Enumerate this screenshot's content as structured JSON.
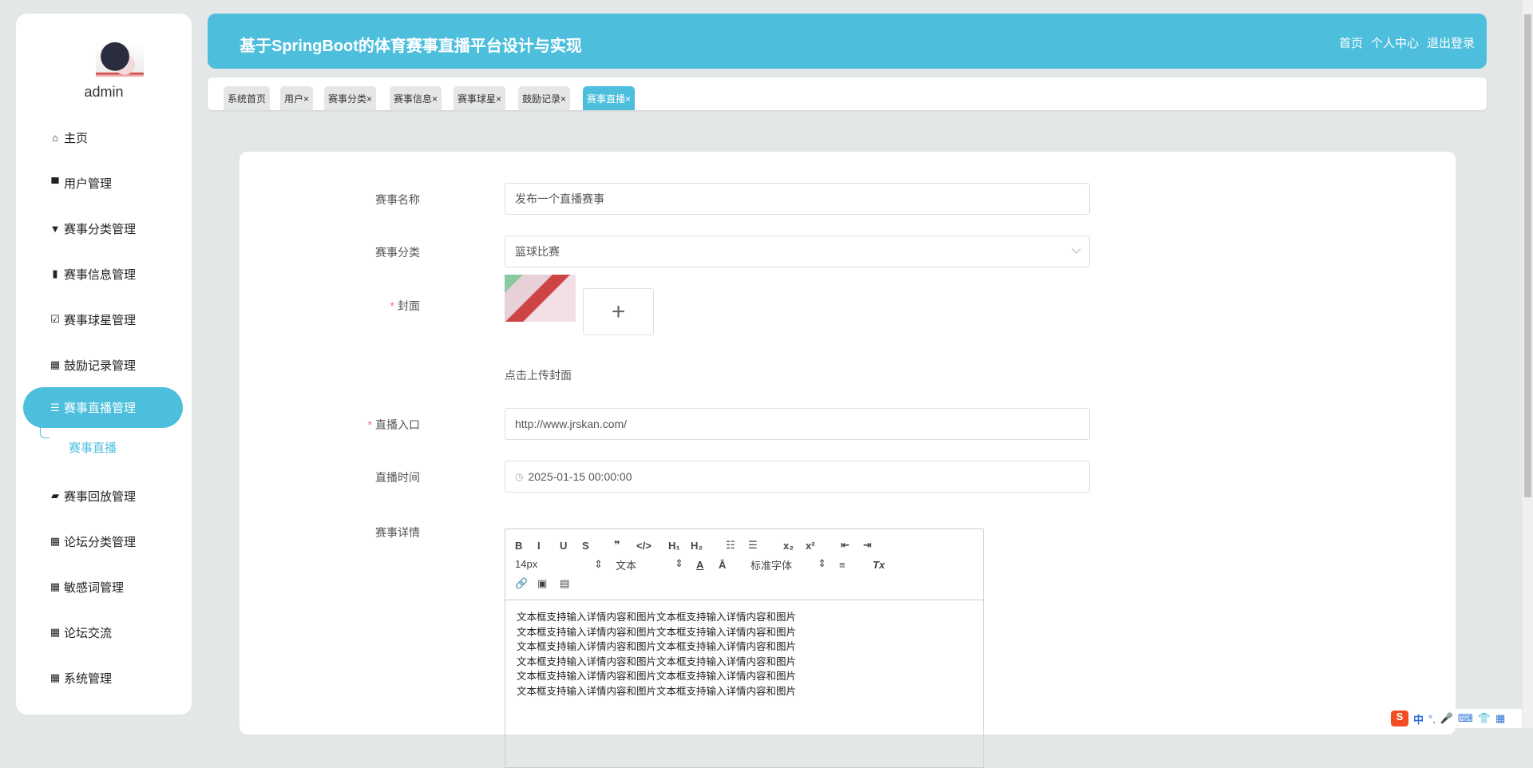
{
  "sidebar": {
    "username": "admin",
    "items": [
      {
        "label": "主页",
        "icon": "home-icon",
        "glyph": "⌂"
      },
      {
        "label": "用户管理",
        "icon": "user-icon",
        "glyph": "▀"
      },
      {
        "label": "赛事分类管理",
        "icon": "category-icon",
        "glyph": "▼"
      },
      {
        "label": "赛事信息管理",
        "icon": "bar-chart-icon",
        "glyph": "▮"
      },
      {
        "label": "赛事球星管理",
        "icon": "clipboard-check-icon",
        "glyph": "☑"
      },
      {
        "label": "鼓励记录管理",
        "icon": "grid-icon",
        "glyph": "▦"
      },
      {
        "label": "赛事直播管理",
        "icon": "sliders-icon",
        "glyph": "☰"
      },
      {
        "label": "赛事回放管理",
        "icon": "wallet-icon",
        "glyph": "▰"
      },
      {
        "label": "论坛分类管理",
        "icon": "grid-icon",
        "glyph": "▦"
      },
      {
        "label": "敏感词管理",
        "icon": "grid-icon",
        "glyph": "▦"
      },
      {
        "label": "论坛交流",
        "icon": "grid-icon",
        "glyph": "▦"
      },
      {
        "label": "系统管理",
        "icon": "grid-icon",
        "glyph": "▦"
      }
    ],
    "sub_item": "赛事直播"
  },
  "header": {
    "title": "基于SpringBoot的体育赛事直播平台设计与实现",
    "links": [
      "首页",
      "个人中心",
      "退出登录"
    ]
  },
  "tabs": [
    "系统首页",
    "用户×",
    "赛事分类×",
    "赛事信息×",
    "赛事球星×",
    "鼓励记录×",
    "赛事直播×"
  ],
  "form": {
    "name_label": "赛事名称",
    "name_value": "发布一个直播赛事",
    "category_label": "赛事分类",
    "category_value": "篮球比赛",
    "cover_label": "封面",
    "upload_hint": "点击上传封面",
    "upload_plus": "+",
    "entry_label": "直播入口",
    "entry_value": "http://www.jrskan.com/",
    "time_label": "直播时间",
    "time_value": "2025-01-15 00:00:00",
    "detail_label": "赛事详情",
    "toolbar": {
      "row1": [
        "B",
        "I",
        "U",
        "S",
        "❞",
        "</>",
        "H₁",
        "H₂",
        "☷",
        "☰",
        "x₂",
        "x²",
        "⇤",
        "⇥"
      ],
      "font_size": "14px",
      "text_type": "文本",
      "font_family": "标准字体",
      "row2_icons": [
        "A",
        "Ā",
        "≡",
        "Tx"
      ],
      "row3": [
        "🔗",
        "▣",
        "▤"
      ]
    },
    "content_lines": [
      "文本框支持输入详情内容和图片文本框支持输入详情内容和图片",
      "文本框支持输入详情内容和图片文本框支持输入详情内容和图片",
      "文本框支持输入详情内容和图片文本框支持输入详情内容和图片",
      "文本框支持输入详情内容和图片文本框支持输入详情内容和图片",
      "文本框支持输入详情内容和图片文本框支持输入详情内容和图片",
      "文本框支持输入详情内容和图片文本框支持输入详情内容和图片"
    ]
  },
  "ime": {
    "logo": "S",
    "lang": "中",
    "punct": "°,"
  }
}
